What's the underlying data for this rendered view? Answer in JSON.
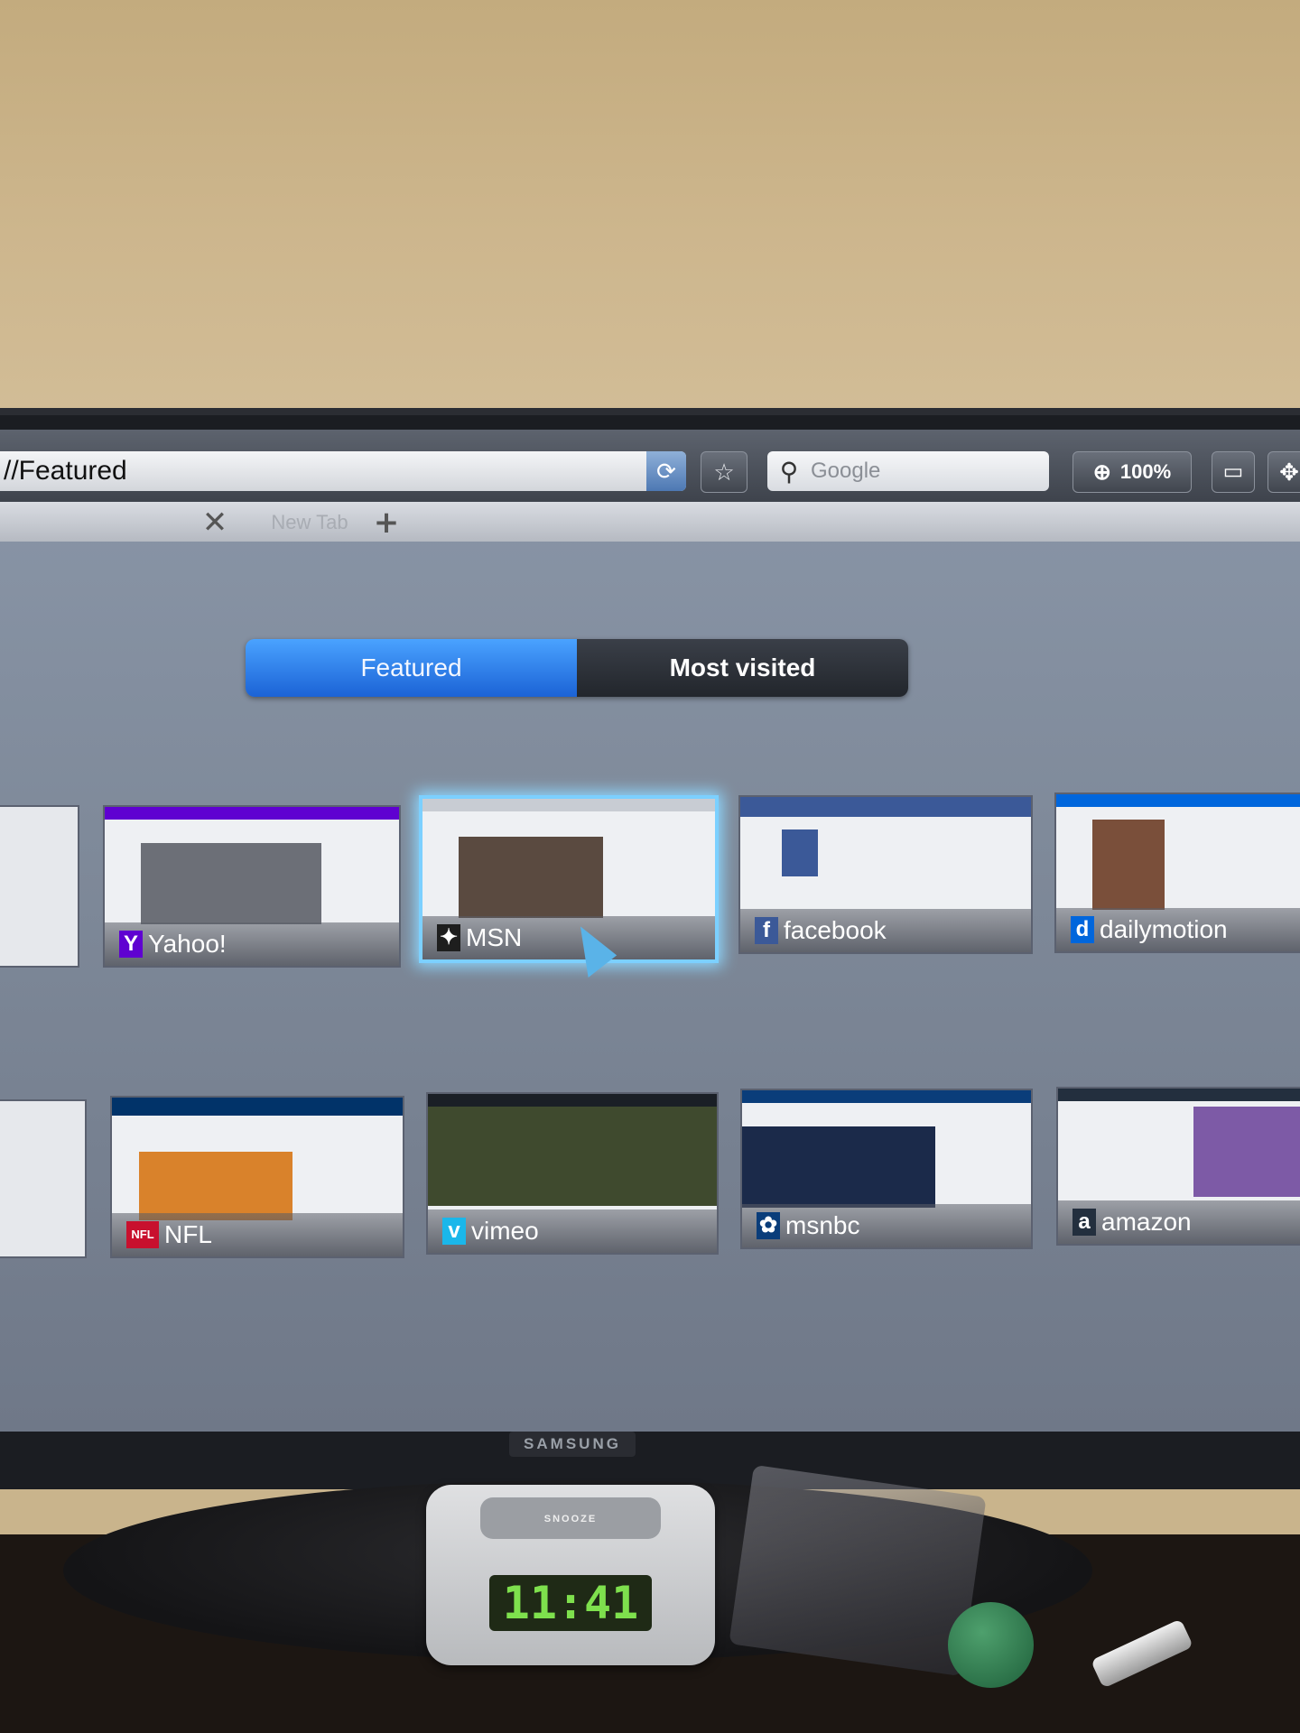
{
  "browser": {
    "url": "//Featured",
    "search_placeholder": "Google",
    "zoom_level": "100%"
  },
  "tabs": {
    "new_tab_label": "New Tab"
  },
  "segmented": {
    "featured": "Featured",
    "most_visited": "Most visited"
  },
  "tiles": [
    {
      "name": "Yahoo!",
      "icon": "Y",
      "color": "#5f01d1"
    },
    {
      "name": "MSN",
      "icon": "✦",
      "color": "#1e1e1e"
    },
    {
      "name": "facebook",
      "icon": "f",
      "color": "#3b5998"
    },
    {
      "name": "dailymotion",
      "icon": "d",
      "color": "#0066dc"
    },
    {
      "name": "NFL",
      "icon": "NFL",
      "color": "#013369"
    },
    {
      "name": "vimeo",
      "icon": "v",
      "color": "#1ab7ea"
    },
    {
      "name": "msnbc",
      "icon": "✿",
      "color": "#0a3d7a"
    },
    {
      "name": "amazon",
      "icon": "a",
      "color": "#232f3e"
    }
  ],
  "tv_brand": "SAMSUNG",
  "clock": {
    "button_label": "SNOOZE",
    "time": "11:41"
  }
}
